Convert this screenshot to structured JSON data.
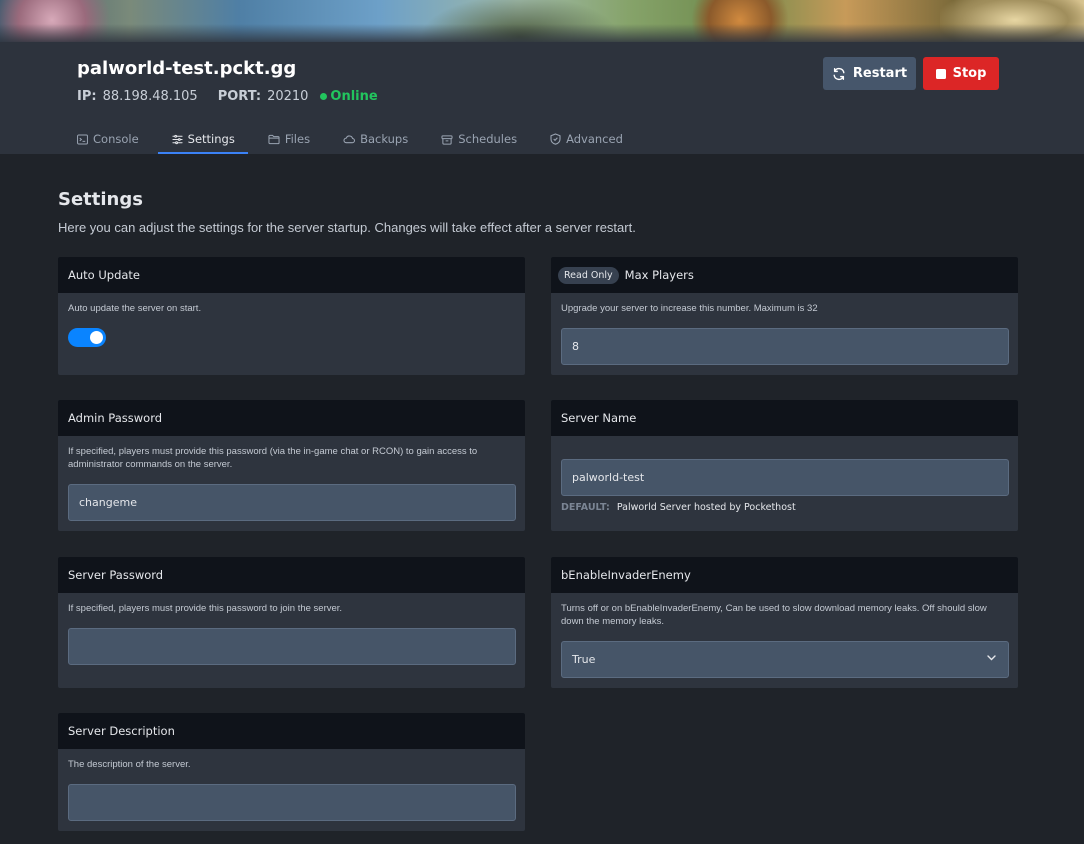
{
  "server": {
    "name": "palworld-test.pckt.gg",
    "ip_label": "IP:",
    "ip": "88.198.48.105",
    "port_label": "PORT:",
    "port": "20210",
    "status": "Online"
  },
  "actions": {
    "restart": "Restart",
    "stop": "Stop"
  },
  "tabs": [
    {
      "label": "Console",
      "icon": "terminal-icon"
    },
    {
      "label": "Settings",
      "icon": "sliders-icon",
      "active": true
    },
    {
      "label": "Files",
      "icon": "folder-icon"
    },
    {
      "label": "Backups",
      "icon": "cloud-icon"
    },
    {
      "label": "Schedules",
      "icon": "archive-icon"
    },
    {
      "label": "Advanced",
      "icon": "shield-icon"
    }
  ],
  "page": {
    "title": "Settings",
    "description": "Here you can adjust the settings for the server startup. Changes will take effect after a server restart."
  },
  "settings": {
    "auto_update": {
      "title": "Auto Update",
      "description": "Auto update the server on start.",
      "enabled": true
    },
    "max_players": {
      "badge": "Read Only",
      "title": "Max Players",
      "description": "Upgrade your server to increase this number. Maximum is 32",
      "value": "8"
    },
    "admin_password": {
      "title": "Admin Password",
      "description": "If specified, players must provide this password (via the in-game chat or RCON) to gain access to administrator commands on the server.",
      "value": "changeme"
    },
    "server_name": {
      "title": "Server Name",
      "value": "palworld-test",
      "default_label": "DEFAULT:",
      "default_value": "Palworld Server hosted by Pockethost"
    },
    "server_password": {
      "title": "Server Password",
      "description": "If specified, players must provide this password to join the server.",
      "value": ""
    },
    "invader_enemy": {
      "title": "bEnableInvaderEnemy",
      "description": "Turns off or on bEnableInvaderEnemy, Can be used to slow download memory leaks. Off should slow down the memory leaks.",
      "value": "True"
    },
    "server_description": {
      "title": "Server Description",
      "description": "The description of the server.",
      "value": ""
    }
  },
  "colors": {
    "accent": "#3b82f6",
    "online": "#22c55e",
    "stop": "#dc2626",
    "toggle": "#0a84ff"
  }
}
